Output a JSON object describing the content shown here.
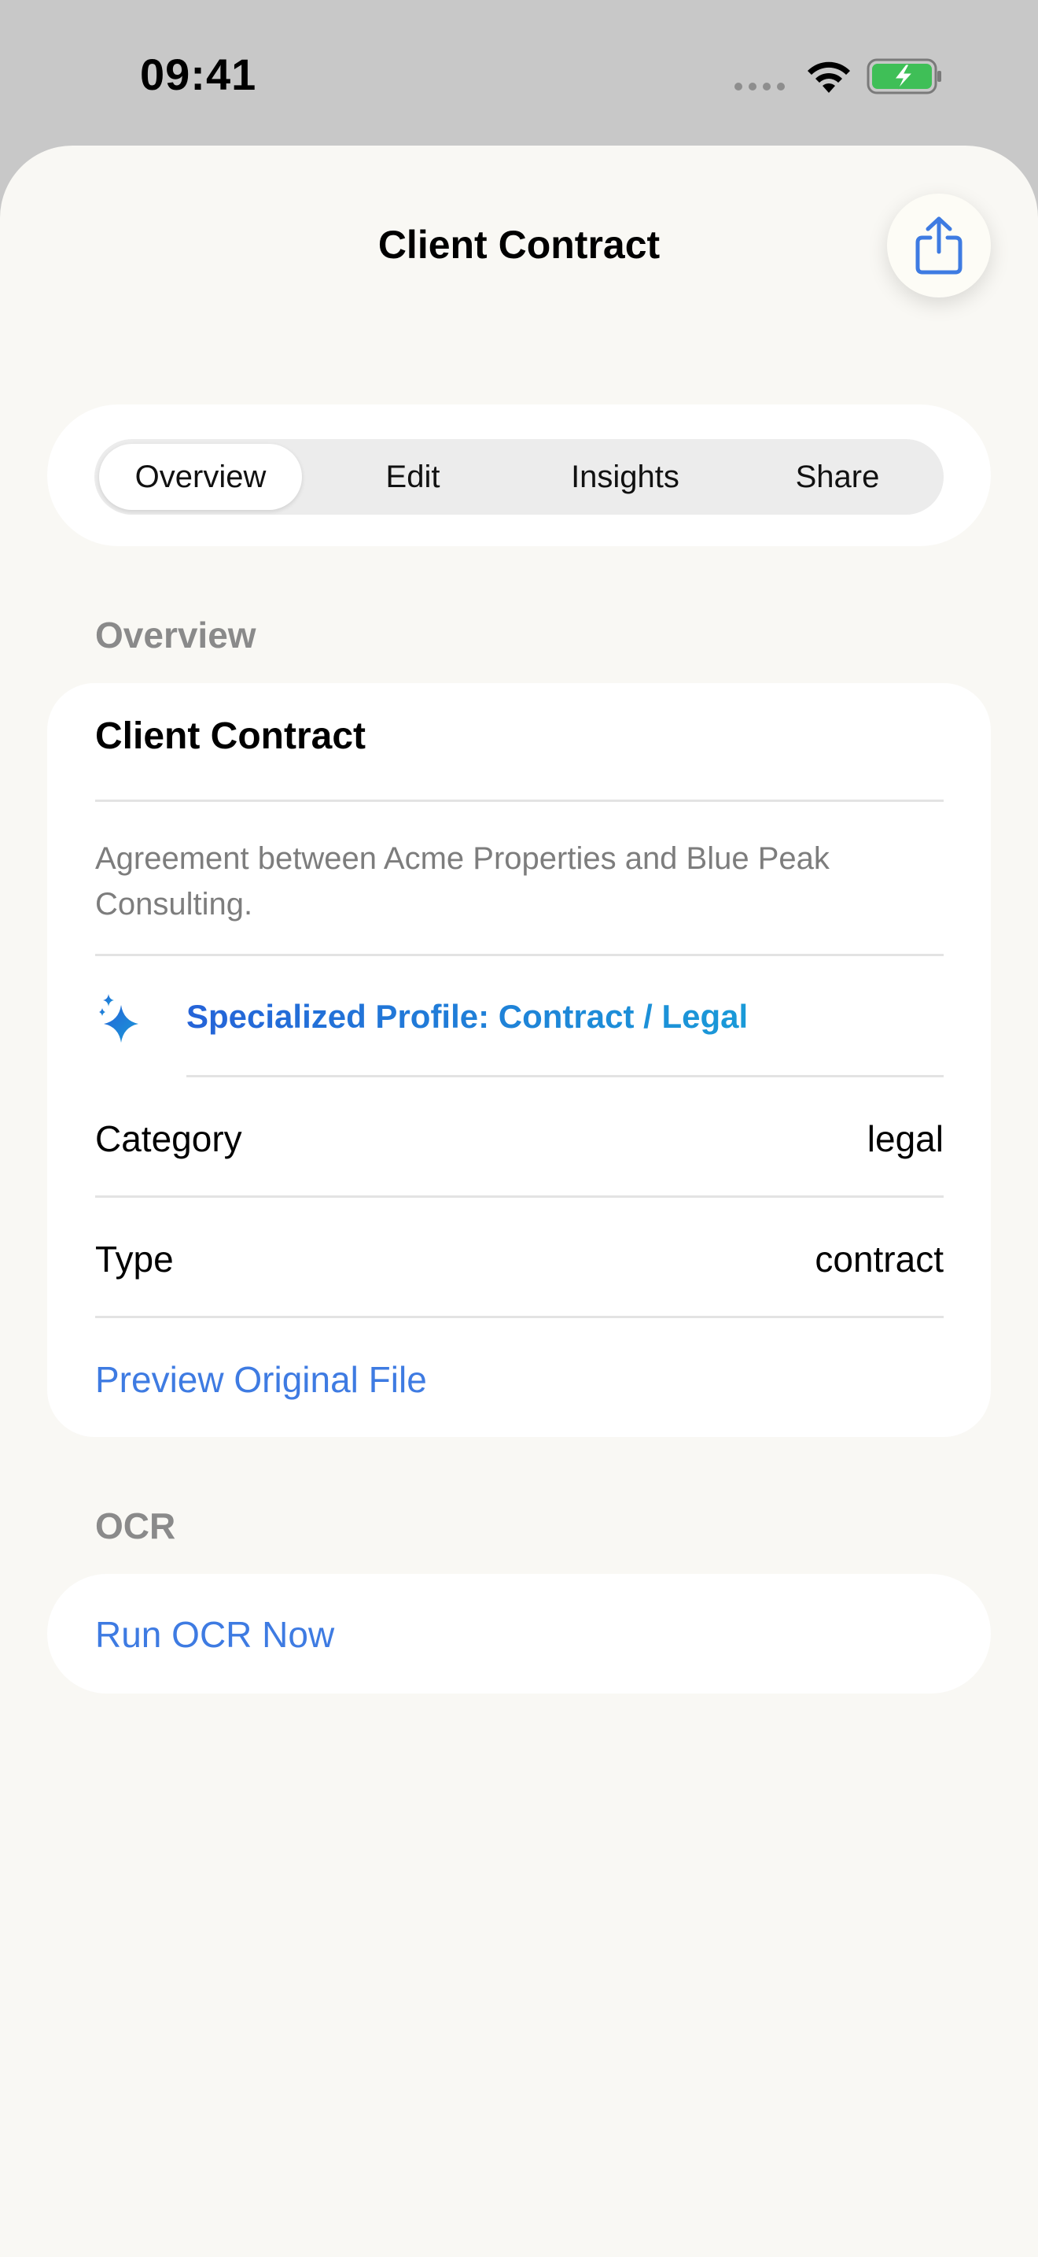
{
  "status_bar": {
    "time": "09:41"
  },
  "nav": {
    "title": "Client Contract",
    "share_icon": "share-icon"
  },
  "tabs": [
    {
      "label": "Overview",
      "active": true
    },
    {
      "label": "Edit",
      "active": false
    },
    {
      "label": "Insights",
      "active": false
    },
    {
      "label": "Share",
      "active": false
    }
  ],
  "overview": {
    "header": "Overview",
    "doc_title": "Client Contract",
    "description": "Agreement between Acme Properties and Blue Peak Consulting.",
    "profile_icon": "sparkle-icon",
    "profile_label": "Specialized Profile: Contract / Legal",
    "category_label": "Category",
    "category_value": "legal",
    "type_label": "Type",
    "type_value": "contract",
    "preview_link": "Preview Original File"
  },
  "ocr": {
    "header": "OCR",
    "run_link": "Run OCR Now"
  },
  "colors": {
    "accent": "#3e7be2",
    "profile_gradient_start": "#2563d8",
    "profile_gradient_end": "#1a9ad8",
    "background": "#f9f8f4",
    "battery_green": "#3fbf57"
  }
}
